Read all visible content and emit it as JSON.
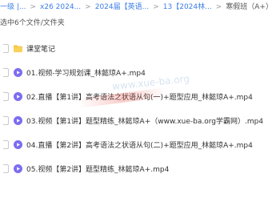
{
  "breadcrumb": {
    "items": [
      "一级 |...",
      "x26 2024...",
      "2024届【英语...",
      "13【2024林...",
      "寒假班（A+）"
    ],
    "separators": [
      ">",
      ">",
      ">",
      ">"
    ]
  },
  "selection": {
    "text": "选中6个文件/文件夹"
  },
  "files": [
    {
      "type": "folder",
      "name": "课堂笔记"
    },
    {
      "type": "video",
      "name": "01.视频-学习规划课_林懿琼A+.mp4"
    },
    {
      "type": "video",
      "name": "02.直播【第1讲】高考语法之状语从句(一)+题型应用_林懿琼A+.mp4"
    },
    {
      "type": "video",
      "name": "03.视频【第1讲】题型精练_林懿琼A+（www.xue-ba.org学霸网）.mp4"
    },
    {
      "type": "video",
      "name": "04.直播【第2讲】高考语法之状语从句(二)+题型应用_林懿琼A+.mp4"
    },
    {
      "type": "video",
      "name": "05.视频【第2讲】题型精练_林懿琼A+.mp4"
    }
  ],
  "watermark": "www.xue-ba.org",
  "colors": {
    "folder": "#f6c344",
    "video": "#7c6cf0",
    "link": "#3b7ee6"
  }
}
